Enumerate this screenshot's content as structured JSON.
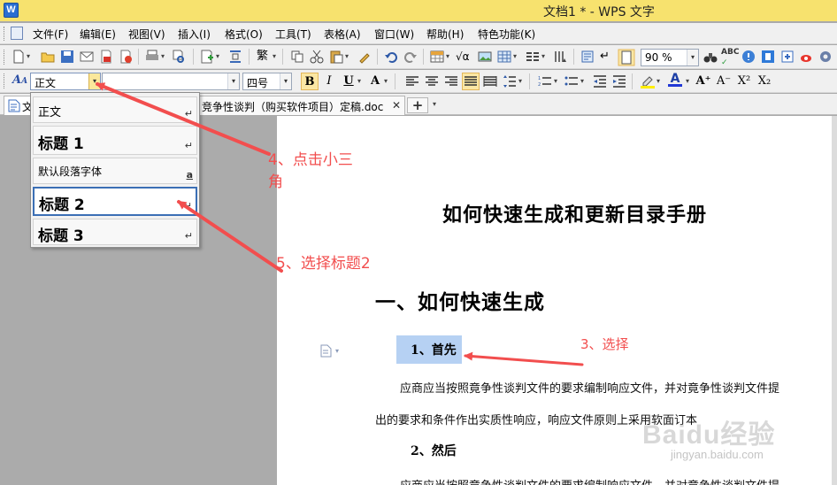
{
  "window": {
    "title": "文档1 * - WPS 文字",
    "app_icon_letter": "W"
  },
  "menu": [
    "文件(F)",
    "编辑(E)",
    "视图(V)",
    "插入(I)",
    "格式(O)",
    "工具(T)",
    "表格(A)",
    "窗口(W)",
    "帮助(H)",
    "特色功能(K)"
  ],
  "toolbar": {
    "zoom": "90 %"
  },
  "format_bar": {
    "style_value": "正文",
    "font_size_value": "四号",
    "bold_label": "B",
    "italic_label": "I",
    "underline_label": "U",
    "char_scale_label": "A",
    "grow_font_label": "A⁺",
    "shrink_font_label": "A⁻",
    "superscript_label": "X²",
    "subscript_label": "X₂"
  },
  "tabs": {
    "doc_tab_1_label": "文",
    "doc_tab_2_label": "竞争性谈判（购买软件项目）定稿.doc"
  },
  "style_menu": {
    "items": [
      {
        "label": "正文",
        "marker": "↵"
      },
      {
        "label": "标题  1",
        "marker": "↵"
      },
      {
        "label": "默认段落字体",
        "marker": "a"
      },
      {
        "label": "标题  2",
        "marker": "↵"
      },
      {
        "label": "标题  3",
        "marker": "↵"
      }
    ]
  },
  "document": {
    "title": "如何快速生成和更新目录手册",
    "heading1": "一、如何快速生成",
    "sub1": "1、首先",
    "para1_line1": "应商应当按照竟争性谈判文件的要求编制响应文件，并对竟争性谈判文件提",
    "para1_line2": "出的要求和条件作出实质性响应，响应文件原则上采用软面订本",
    "sub2": "2、然后",
    "para2_line1": "应商应当按照竟争性谈判文件的要求编制响应文件，并对竟争性谈判文件提"
  },
  "annotations": {
    "step4_line1": "4、点击小三",
    "step4_line2": "角",
    "step5": "5、选择标题2",
    "step3": "3、选择",
    "color": "#f24e4e"
  },
  "watermark": {
    "brand": "Baidu经验",
    "url": "jingyan.baidu.com"
  },
  "icons": [
    "new-doc-icon",
    "open-icon",
    "save-icon",
    "print-icon",
    "undo-icon",
    "redo-icon",
    "spell-check-icon",
    "paragraph-marks-icon",
    "styles-icon",
    "menu-return-icon"
  ]
}
